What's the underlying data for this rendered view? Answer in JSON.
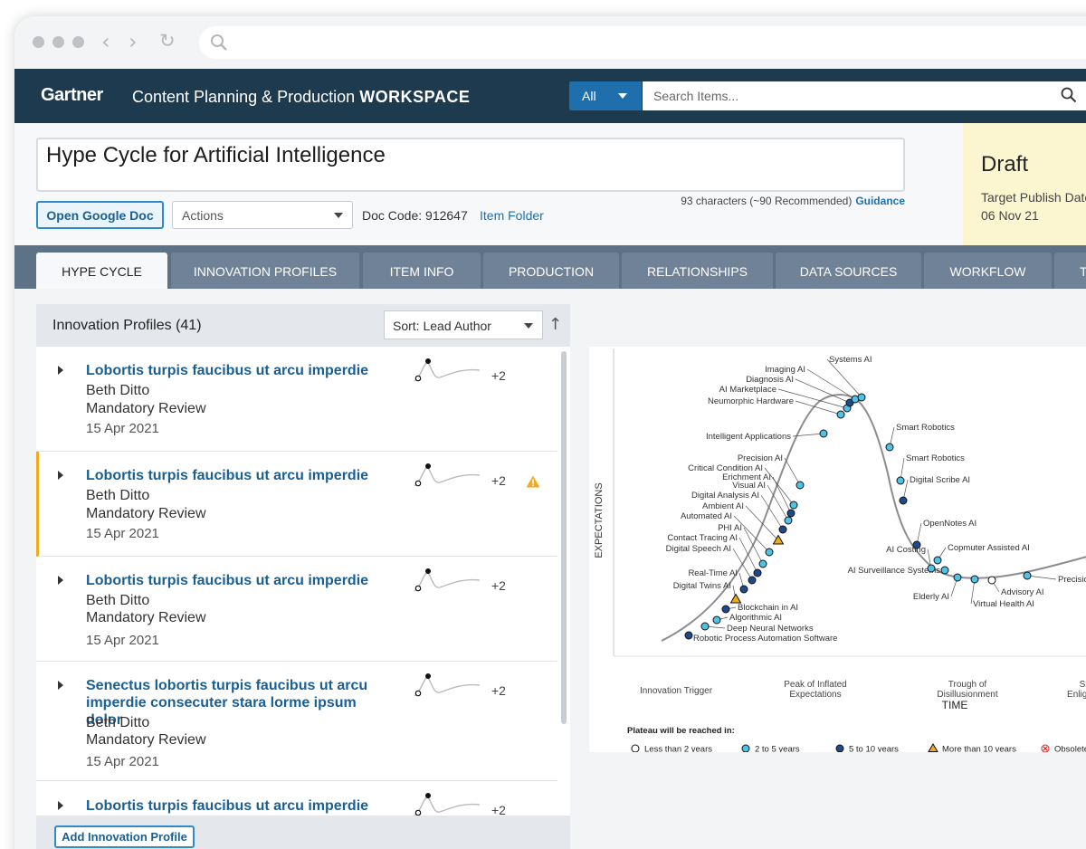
{
  "browser": {
    "url": ""
  },
  "header": {
    "logo": "Gartner",
    "app_title": "Content Planning & Production",
    "app_title_bold": "WORKSPACE",
    "search_scope": "All",
    "search_placeholder": "Search Items..."
  },
  "document": {
    "title": "Hype Cycle for Artificial Intelligence",
    "char_count": "93 characters (~90 Recommended)",
    "guidance_link": "Guidance",
    "open_doc_button": "Open Google Doc",
    "actions_label": "Actions",
    "doc_code": "Doc Code: 912647",
    "item_folder": "Item Folder",
    "status": "Draft",
    "publish_label": "Target Publish Date",
    "publish_date": "06 Nov 21"
  },
  "tabs": [
    {
      "label": "HYPE CYCLE",
      "active": true
    },
    {
      "label": "INNOVATION PROFILES"
    },
    {
      "label": "ITEM INFO"
    },
    {
      "label": "PRODUCTION"
    },
    {
      "label": "RELATIONSHIPS"
    },
    {
      "label": "DATA SOURCES"
    },
    {
      "label": "WORKFLOW"
    },
    {
      "label": "T"
    }
  ],
  "profiles": {
    "heading": "Innovation Profiles (41)",
    "sort_label": "Sort: Lead Author",
    "add_button": "Add Innovation Profile",
    "items": [
      {
        "title": "Lobortis turpis faucibus ut arcu imperdie",
        "author": "Beth Ditto",
        "review": "Mandatory Review",
        "date": "15 Apr 2021",
        "extra": "+2",
        "warning": false
      },
      {
        "title": "Lobortis turpis faucibus ut arcu imperdie",
        "author": "Beth Ditto",
        "review": "Mandatory Review",
        "date": "15 Apr 2021",
        "extra": "+2",
        "warning": true
      },
      {
        "title": "Lobortis turpis faucibus ut arcu imperdie",
        "author": "Beth Ditto",
        "review": "Mandatory Review",
        "date": "15 Apr 2021",
        "extra": "+2",
        "warning": false
      },
      {
        "title": "Senectus lobortis turpis faucibus ut arcu imperdie consecuter stara lorme ipsum dolor",
        "author": "Beth Ditto",
        "review": "Mandatory Review",
        "date": "15 Apr 2021",
        "extra": "+2",
        "warning": false
      },
      {
        "title": "Lobortis turpis faucibus ut arcu imperdie",
        "author": "",
        "review": "",
        "date": "",
        "extra": "+2",
        "warning": false
      }
    ]
  },
  "hype_cycle": {
    "y_axis": "EXPECTATIONS",
    "x_axis": "TIME",
    "phases": [
      "Innovation Trigger",
      "Peak of Inflated Expectations",
      "Trough of Disillusionment",
      "Slope of Enlightenment"
    ],
    "legend_title": "Plateau will be reached in:",
    "legend": [
      {
        "label": "Less than 2 years",
        "marker": "circle-white"
      },
      {
        "label": "2 to 5 years",
        "marker": "circle-cyan"
      },
      {
        "label": "5 to 10 years",
        "marker": "circle-navy"
      },
      {
        "label": "More than 10 years",
        "marker": "triangle-orange"
      },
      {
        "label": "Obsolete before plateau",
        "marker": "x-red"
      }
    ],
    "colors": {
      "lt2": "#ffffff",
      "c2to5": "#4fc3e6",
      "c5to10": "#1f4a8a",
      "gt10": "#f1a91e",
      "obsolete": "#e02020",
      "curve": "#8a8d91"
    },
    "points": [
      {
        "label": "Robotic Process Automation Software",
        "cat": "c5to10"
      },
      {
        "label": "Deep Neural Networks",
        "cat": "c2to5"
      },
      {
        "label": "Algorithmic AI",
        "cat": "c2to5"
      },
      {
        "label": "Blockchain in AI",
        "cat": "c5to10"
      },
      {
        "label": "Digital Twins AI",
        "cat": "gt10"
      },
      {
        "label": "Real-Time AI",
        "cat": "c5to10"
      },
      {
        "label": "Digital Speech AI",
        "cat": "c5to10"
      },
      {
        "label": "Contact Tracing AI",
        "cat": "c5to10"
      },
      {
        "label": "PHI AI",
        "cat": "c2to5"
      },
      {
        "label": "Automated AI",
        "cat": "c2to5"
      },
      {
        "label": "Ambient AI",
        "cat": "gt10"
      },
      {
        "label": "Digital Analysis AI",
        "cat": "c5to10"
      },
      {
        "label": "Visual AI",
        "cat": "c2to5"
      },
      {
        "label": "Erichment AI",
        "cat": "c5to10"
      },
      {
        "label": "Critical Condition AI",
        "cat": "c2to5"
      },
      {
        "label": "Precision AI",
        "cat": "c2to5"
      },
      {
        "label": "Intelligent Applications",
        "cat": "c2to5"
      },
      {
        "label": "Neumorphic Hardware",
        "cat": "c2to5"
      },
      {
        "label": "AI Marketplace",
        "cat": "c2to5"
      },
      {
        "label": "Diagnosis AI",
        "cat": "c5to10"
      },
      {
        "label": "Imaging AI",
        "cat": "c2to5"
      },
      {
        "label": "Systems AI",
        "cat": "c2to5"
      },
      {
        "label": "Smart Robotics",
        "cat": "c2to5"
      },
      {
        "label": "Smart Robotics",
        "cat": "c2to5"
      },
      {
        "label": "Digital Scribe AI",
        "cat": "c5to10"
      },
      {
        "label": "OpenNotes AI",
        "cat": "c5to10"
      },
      {
        "label": "AI Costing",
        "cat": "c2to5"
      },
      {
        "label": "Copmuter Assisted AI",
        "cat": "c2to5"
      },
      {
        "label": "AI Surveillance Systems",
        "cat": "c2to5"
      },
      {
        "label": "Elderly AI",
        "cat": "c2to5"
      },
      {
        "label": "Virtual Health AI",
        "cat": "c2to5"
      },
      {
        "label": "Advisory AI",
        "cat": "lt2"
      },
      {
        "label": "Precision A",
        "cat": "c2to5"
      }
    ]
  }
}
